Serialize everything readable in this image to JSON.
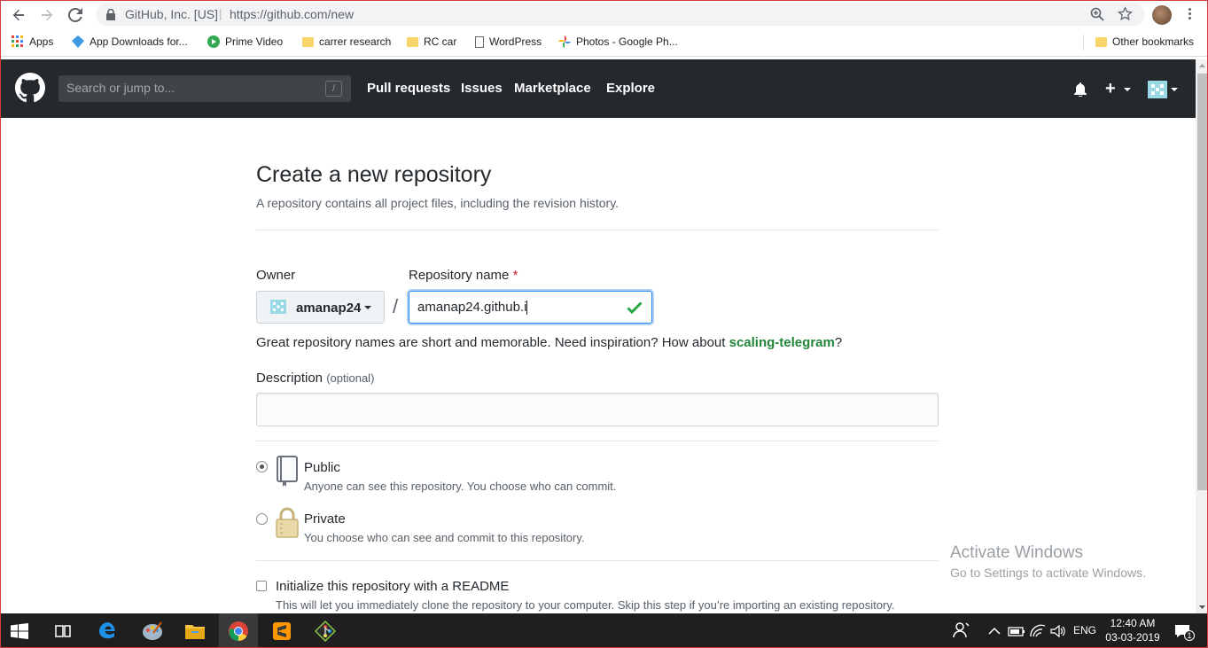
{
  "browser": {
    "site_identity": "GitHub, Inc. [US]",
    "url": "https://github.com/new",
    "bookmarks": [
      {
        "label": "Apps",
        "icon": "apps-grid-icon"
      },
      {
        "label": "App Downloads for...",
        "icon": "download-icon"
      },
      {
        "label": "Prime Video",
        "icon": "play-icon"
      },
      {
        "label": "carrer research",
        "icon": "folder-icon"
      },
      {
        "label": "RC car",
        "icon": "folder-icon"
      },
      {
        "label": "WordPress",
        "icon": "page-icon"
      },
      {
        "label": "Photos - Google Ph...",
        "icon": "pinwheel-icon"
      }
    ],
    "other_bookmarks": "Other bookmarks"
  },
  "github_header": {
    "search_placeholder": "Search or jump to...",
    "search_shortcut": "/",
    "nav": [
      "Pull requests",
      "Issues",
      "Marketplace",
      "Explore"
    ],
    "plus": "+"
  },
  "form": {
    "title": "Create a new repository",
    "subtitle": "A repository contains all project files, including the revision history.",
    "owner_label": "Owner",
    "owner_value": "amanap24",
    "slash": "/",
    "repo_label": "Repository name",
    "repo_required_mark": "*",
    "repo_value": "amanap24.github.i",
    "hint_prefix": "Great repository names are short and memorable. Need inspiration? How about ",
    "hint_suggestion": "scaling-telegram",
    "hint_suffix": "?",
    "description_label": "Description",
    "description_optional": "(optional)",
    "description_value": "",
    "visibility_options": [
      {
        "title": "Public",
        "note": "Anyone can see this repository. You choose who can commit.",
        "selected": true
      },
      {
        "title": "Private",
        "note": "You choose who can see and commit to this repository.",
        "selected": false
      }
    ],
    "readme_title": "Initialize this repository with a README",
    "readme_note": "This will let you immediately clone the repository to your computer. Skip this step if you’re importing an existing repository.",
    "readme_checked": false
  },
  "watermark": {
    "line1": "Activate Windows",
    "line2": "Go to Settings to activate Windows."
  },
  "taskbar": {
    "lang": "ENG",
    "time": "12:40 AM",
    "date": "03-03-2019",
    "notification_count": "1"
  },
  "colors": {
    "gh_header": "#24292e",
    "accent_blue": "#2188ff",
    "success_green": "#28a745"
  }
}
